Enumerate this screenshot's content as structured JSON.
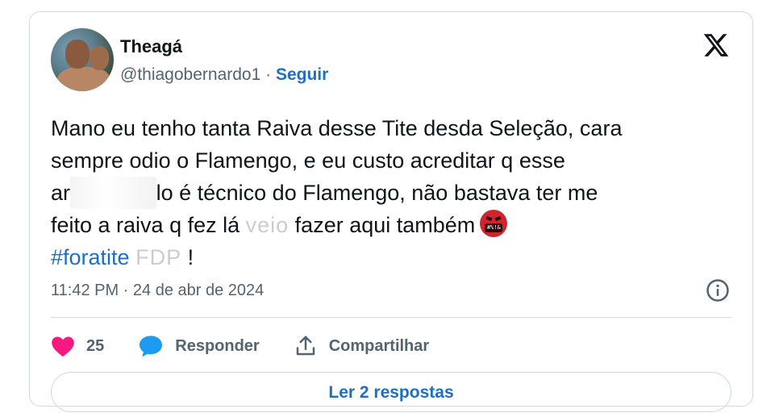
{
  "author": {
    "display_name": "Theagá",
    "handle": "@thiagobernardo1",
    "separator": " · ",
    "follow_label": "Seguir"
  },
  "tweet": {
    "lines": [
      "Mano eu tenho tanta Raiva desse Tite desda  Seleção, cara",
      "sempre odio o Flamengo, e eu custo acreditar q esse"
    ],
    "line3_start": "ar",
    "line3_censored": "rombado",
    "line3_end": "lo é técnico do Flamengo, não bastava ter me",
    "line4_start": "feito a raiva q fez lá ",
    "line4_censored": "veio",
    "line4_end": " fazer aqui também",
    "emoji_text": "#%!&",
    "hashtag": "#foratite",
    "hashtag_censored": "FDP",
    "closing": " !"
  },
  "timestamp": "11:42 PM · 24 de abr de 2024",
  "actions": {
    "like_count": "25",
    "reply_label": "Responder",
    "share_label": "Compartilhar"
  },
  "reply_bar_label": "Ler 2 respostas",
  "colors": {
    "accent": "#1d6fc4",
    "like": "#f91880",
    "text": "#0f1419",
    "muted": "#536471",
    "border": "#cfd9de"
  },
  "icons": {
    "logo": "x-logo-icon",
    "info": "info-icon",
    "like": "heart-icon",
    "reply": "speech-bubble-icon",
    "share": "share-upload-icon",
    "emoji": "cursing-face-emoji"
  }
}
